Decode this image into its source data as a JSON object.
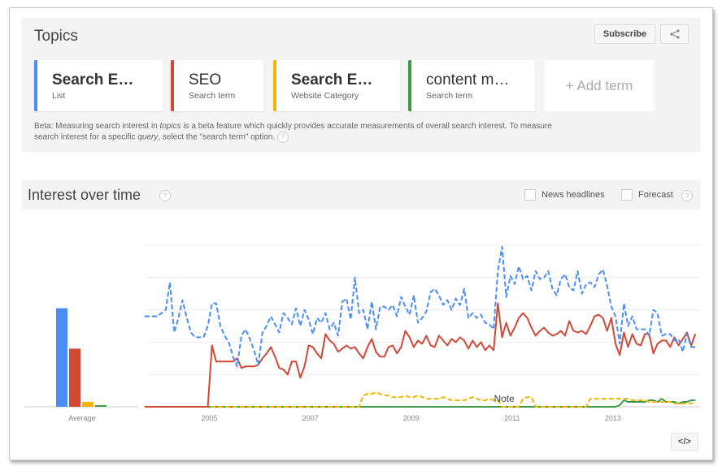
{
  "topics": {
    "title": "Topics",
    "subscribe_label": "Subscribe",
    "share_icon": "share-icon",
    "terms": [
      {
        "name": "Search E…",
        "type": "List",
        "color": "#4a8df6",
        "bold": true
      },
      {
        "name": "SEO",
        "type": "Search term",
        "color": "#d14836",
        "bold": false
      },
      {
        "name": "Search E…",
        "type": "Website Category",
        "color": "#f4b400",
        "bold": true
      },
      {
        "name": "content m…",
        "type": "Search term",
        "color": "#3d9b48",
        "bold": false
      }
    ],
    "add_term_label": "+ Add term",
    "beta_text_1": "Beta: Measuring search interest in ",
    "beta_text_topics": "topics",
    "beta_text_2": " is a beta feature which quickly provides accurate measurements of overall search interest. To measure search interest for a specific ",
    "beta_text_query": "query",
    "beta_text_3": ", select the \"search term\" option.",
    "help_glyph": "?"
  },
  "interest": {
    "title": "Interest over time",
    "help_glyph": "?",
    "news_headlines_label": "News headlines",
    "news_headlines_checked": false,
    "forecast_label": "Forecast",
    "forecast_checked": false,
    "embed_label": "</>"
  },
  "chart_data": {
    "type": "line",
    "title": "Interest over time",
    "xlabel": "",
    "ylabel": "",
    "ylim": [
      0,
      100
    ],
    "grid": true,
    "x_start": "2004-01",
    "x_step": "month",
    "x_tick_labels": [
      "2005",
      "2007",
      "2009",
      "2011",
      "2013"
    ],
    "x_tick_index": [
      15,
      39,
      63,
      87,
      111
    ],
    "annotation": {
      "label": "Note",
      "index": 85
    },
    "average": {
      "label": "Average",
      "values": [
        61,
        36,
        3,
        1
      ]
    },
    "series": [
      {
        "name": "Search E… (List)",
        "color": "#4a8df6",
        "dashed": true,
        "values": [
          56,
          56,
          56,
          56,
          58,
          60,
          77,
          46,
          55,
          66,
          55,
          46,
          43,
          43,
          43,
          50,
          64,
          64,
          50,
          44,
          40,
          31,
          25,
          44,
          48,
          42,
          35,
          26,
          46,
          50,
          56,
          51,
          46,
          58,
          55,
          51,
          61,
          50,
          60,
          54,
          45,
          55,
          52,
          58,
          48,
          52,
          44,
          65,
          67,
          54,
          80,
          58,
          60,
          48,
          65,
          48,
          62,
          62,
          60,
          63,
          56,
          68,
          62,
          57,
          69,
          52,
          55,
          59,
          71,
          73,
          69,
          63,
          66,
          60,
          67,
          63,
          73,
          55,
          58,
          55,
          57,
          52,
          51,
          48,
          84,
          99,
          68,
          81,
          76,
          87,
          79,
          81,
          72,
          84,
          79,
          80,
          84,
          73,
          69,
          79,
          82,
          74,
          72,
          84,
          70,
          76,
          77,
          74,
          82,
          85,
          75,
          62,
          56,
          39,
          64,
          50,
          56,
          48,
          48,
          48,
          44,
          60,
          58,
          44,
          45,
          45,
          41,
          42,
          34,
          45,
          37,
          37
        ]
      },
      {
        "name": "SEO (Search term)",
        "color": "#d14836",
        "dashed": false,
        "values": [
          0,
          0,
          0,
          0,
          0,
          0,
          0,
          0,
          0,
          0,
          0,
          0,
          0,
          0,
          0,
          0,
          38,
          28,
          28,
          28,
          28,
          28,
          30,
          24,
          25,
          25,
          25,
          26,
          30,
          33,
          37,
          31,
          24,
          23,
          20,
          28,
          28,
          18,
          25,
          38,
          37,
          33,
          30,
          45,
          41,
          39,
          34,
          36,
          38,
          36,
          37,
          33,
          30,
          37,
          42,
          34,
          31,
          31,
          37,
          38,
          33,
          37,
          47,
          43,
          37,
          41,
          39,
          44,
          38,
          37,
          44,
          41,
          38,
          42,
          40,
          43,
          41,
          36,
          41,
          37,
          40,
          35,
          38,
          35,
          64,
          43,
          52,
          44,
          49,
          55,
          58,
          55,
          49,
          44,
          47,
          49,
          46,
          44,
          45,
          47,
          44,
          53,
          47,
          46,
          47,
          45,
          50,
          56,
          57,
          55,
          47,
          55,
          39,
          32,
          46,
          37,
          45,
          39,
          38,
          45,
          45,
          33,
          39,
          41,
          41,
          37,
          43,
          38,
          42,
          46,
          38,
          45
        ]
      },
      {
        "name": "Search E… (Website Category)",
        "color": "#f4b400",
        "dashed": true,
        "values": [
          0,
          0,
          0,
          0,
          0,
          0,
          0,
          0,
          0,
          0,
          0,
          0,
          0,
          0,
          0,
          0,
          0,
          0,
          0,
          0,
          0,
          0,
          0,
          0,
          0,
          0,
          0,
          0,
          0,
          0,
          0,
          0,
          0,
          0,
          0,
          0,
          0,
          0,
          0,
          0,
          0,
          0,
          0,
          0,
          0,
          0,
          0,
          0,
          0,
          0,
          0,
          0,
          7,
          8,
          8,
          9,
          8,
          7,
          7,
          6,
          6,
          6,
          7,
          6,
          6,
          7,
          6,
          5,
          5,
          5,
          5,
          6,
          5,
          4,
          4,
          4,
          4,
          5,
          6,
          5,
          4,
          4,
          5,
          4,
          4,
          0,
          0,
          0,
          0,
          0,
          5,
          6,
          6,
          0,
          0,
          0,
          0,
          0,
          0,
          0,
          0,
          0,
          0,
          0,
          0,
          0,
          5,
          5,
          5,
          5,
          5,
          5,
          5,
          5,
          5,
          5,
          4,
          4,
          4,
          4,
          3,
          3,
          3,
          3,
          3,
          3,
          2,
          2,
          2,
          2,
          2,
          3
        ]
      },
      {
        "name": "content m… (Search term)",
        "color": "#3d9b48",
        "dashed": false,
        "values": [
          0,
          0,
          0,
          0,
          0,
          0,
          0,
          0,
          0,
          0,
          0,
          0,
          0,
          0,
          0,
          0,
          0,
          0,
          0,
          0,
          0,
          0,
          0,
          0,
          0,
          0,
          0,
          0,
          0,
          0,
          0,
          0,
          0,
          0,
          0,
          0,
          0,
          0,
          0,
          0,
          0,
          0,
          0,
          0,
          0,
          0,
          0,
          0,
          0,
          0,
          0,
          0,
          0,
          0,
          0,
          0,
          0,
          0,
          0,
          0,
          0,
          0,
          0,
          0,
          0,
          0,
          0,
          0,
          0,
          0,
          0,
          0,
          0,
          0,
          0,
          0,
          0,
          0,
          0,
          0,
          0,
          0,
          0,
          0,
          0,
          0,
          0,
          0,
          0,
          0,
          0,
          0,
          0,
          0,
          0,
          0,
          0,
          0,
          0,
          0,
          0,
          0,
          0,
          0,
          0,
          0,
          0,
          0,
          0,
          0,
          0,
          0,
          0,
          1,
          4,
          3,
          3,
          3,
          3,
          3,
          4,
          4,
          3,
          5,
          3,
          3,
          3,
          2,
          3,
          3,
          4,
          4
        ]
      }
    ]
  }
}
